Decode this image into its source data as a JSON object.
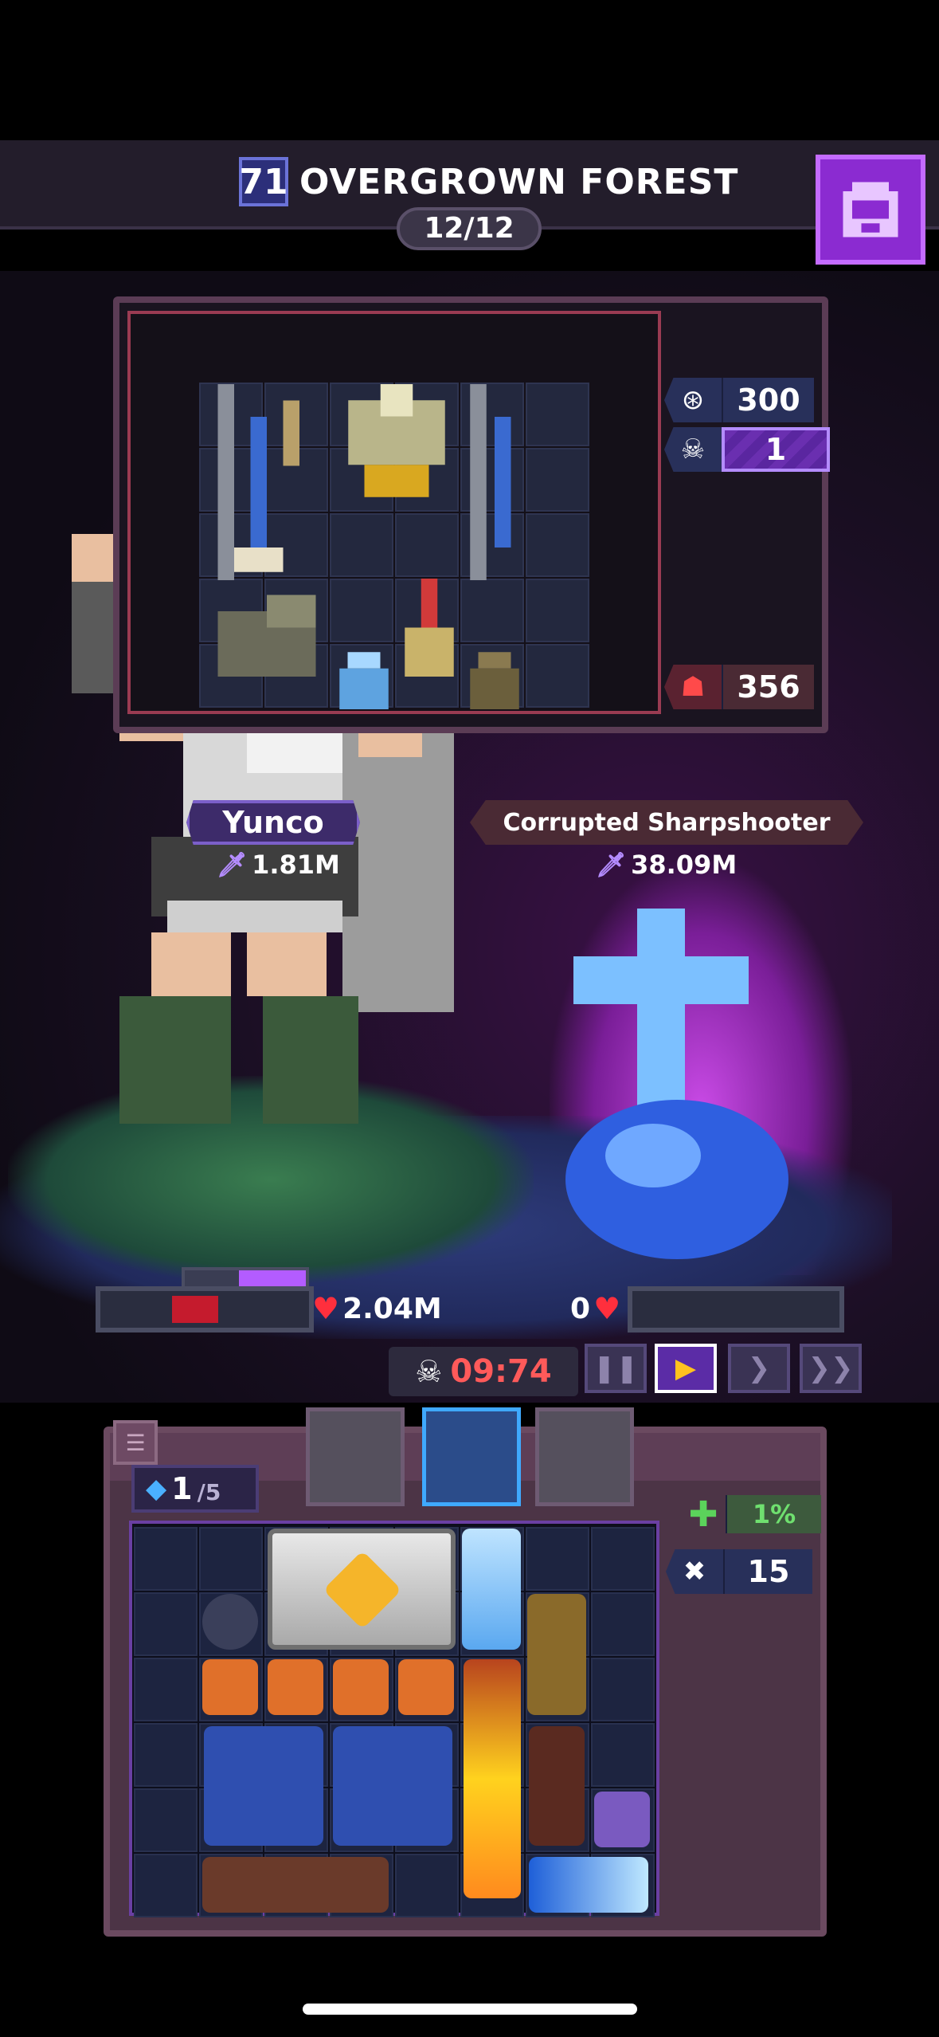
{
  "header": {
    "level": "71",
    "stage_title": "OVERGROWN FOREST",
    "wave_progress": "12/12",
    "bag_icon": "backpack-icon"
  },
  "loot_panel": {
    "gold": "300",
    "kills": "1",
    "enemy_item_power": "356"
  },
  "hero": {
    "name": "Yunco",
    "power": "1.81M",
    "hp": "2.04M",
    "hp_fraction": 0.22,
    "shield_fraction": 0.55
  },
  "enemy": {
    "name": "Corrupted Sharpshooter",
    "power": "38.09M",
    "hp": "0"
  },
  "battle": {
    "timer": "09:74",
    "speed_options": [
      "pause",
      "play",
      "fast",
      "fastest"
    ],
    "selected_speed": "play"
  },
  "inventory": {
    "gems": "1",
    "gems_max": "/5",
    "heal_percent": "1%",
    "enemies_count": "15"
  },
  "colors": {
    "accent_purple": "#8b2bd1",
    "hp_red": "#c51b2d",
    "timer_red": "#ff5a5a",
    "heal_green": "#5bd35b"
  }
}
